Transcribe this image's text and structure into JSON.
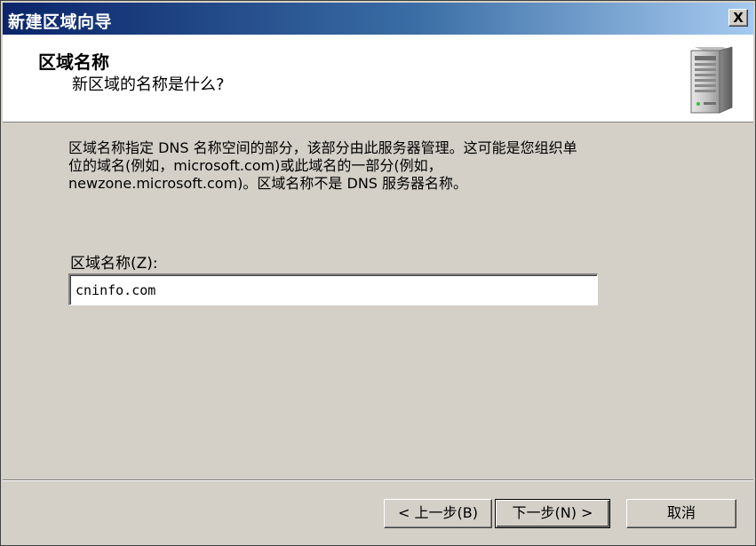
{
  "window": {
    "title": "新建区域向导",
    "close_label": "X"
  },
  "header": {
    "title": "区域名称",
    "subtitle": "新区域的名称是什么?",
    "icon": "server-icon"
  },
  "description": {
    "line1": "区域名称指定 DNS 名称空间的部分，该部分由此服务器管理。这可能是您组织单",
    "line2": "位的域名(例如，microsoft.com)或此域名的一部分(例如，",
    "line3": "newzone.microsoft.com)。区域名称不是 DNS 服务器名称。"
  },
  "form": {
    "zone_label": "区域名称(Z):",
    "zone_value": "cninfo.com"
  },
  "buttons": {
    "back": "< 上一步(B)",
    "next": "下一步(N) >",
    "cancel": "取消"
  },
  "colors": {
    "titlebar_start": "#0a246a",
    "titlebar_end": "#a6caf0",
    "face": "#d4d0c8"
  }
}
